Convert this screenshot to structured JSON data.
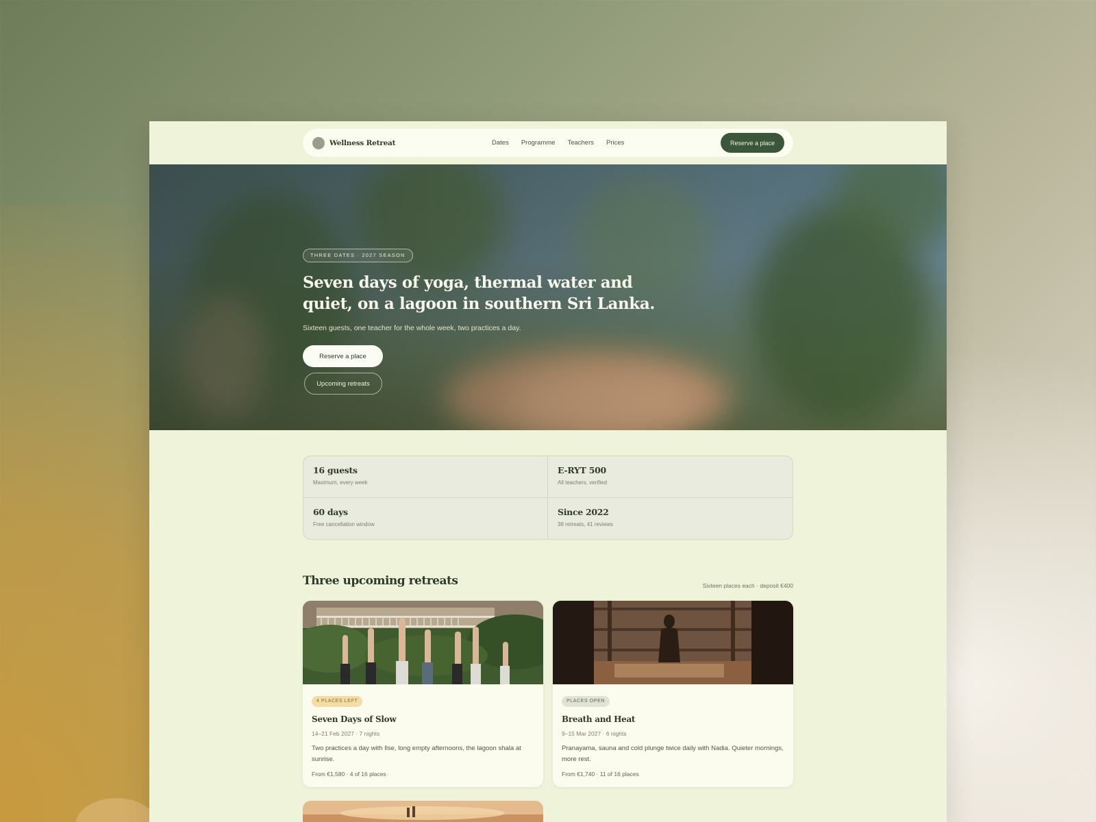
{
  "colors": {
    "accent": "#3a563b",
    "page_bg": "#eef3d9",
    "badge_warn": "#f2dca8",
    "badge_open": "#e1e3d4"
  },
  "header": {
    "logo_icon": "logo-circle",
    "brand": "Wellness Retreat",
    "nav": [
      "Dates",
      "Programme",
      "Teachers",
      "Prices"
    ],
    "cta": "Reserve a place"
  },
  "hero": {
    "badge": "THREE DATES · 2027 SEASON",
    "title": "Seven days of yoga, thermal water and quiet, on a lagoon in southern Sri Lanka.",
    "subtitle": "Sixteen guests, one teacher for the whole week, two practices a day.",
    "primary_button": "Reserve a place",
    "secondary_button": "Upcoming retreats"
  },
  "stats": [
    {
      "title": "16 guests",
      "sub": "Maximum, every week"
    },
    {
      "title": "E-RYT 500",
      "sub": "All teachers, verified"
    },
    {
      "title": "60 days",
      "sub": "Free cancellation window"
    },
    {
      "title": "Since 2022",
      "sub": "38 retreats, 41 reviews"
    }
  ],
  "retreats": {
    "title": "Three upcoming retreats",
    "note": "Sixteen places each · deposit €400",
    "cards": [
      {
        "badge": "4 PLACES LEFT",
        "title": "Seven Days of Slow",
        "dates": "14–21 Feb 2027 · 7 nights",
        "desc": "Two practices a day with Ilse, long empty afternoons, the lagoon shala at sunrise.",
        "price": "From €1,580 · 4 of 16 places"
      },
      {
        "badge": "PLACES OPEN",
        "title": "Breath and Heat",
        "dates": "9–15 Mar 2027 · 6 nights",
        "desc": "Pranayama, sauna and cold plunge twice daily with Nadia. Quieter mornings, more rest.",
        "price": "From €1,740 · 11 of 16 places"
      }
    ]
  }
}
